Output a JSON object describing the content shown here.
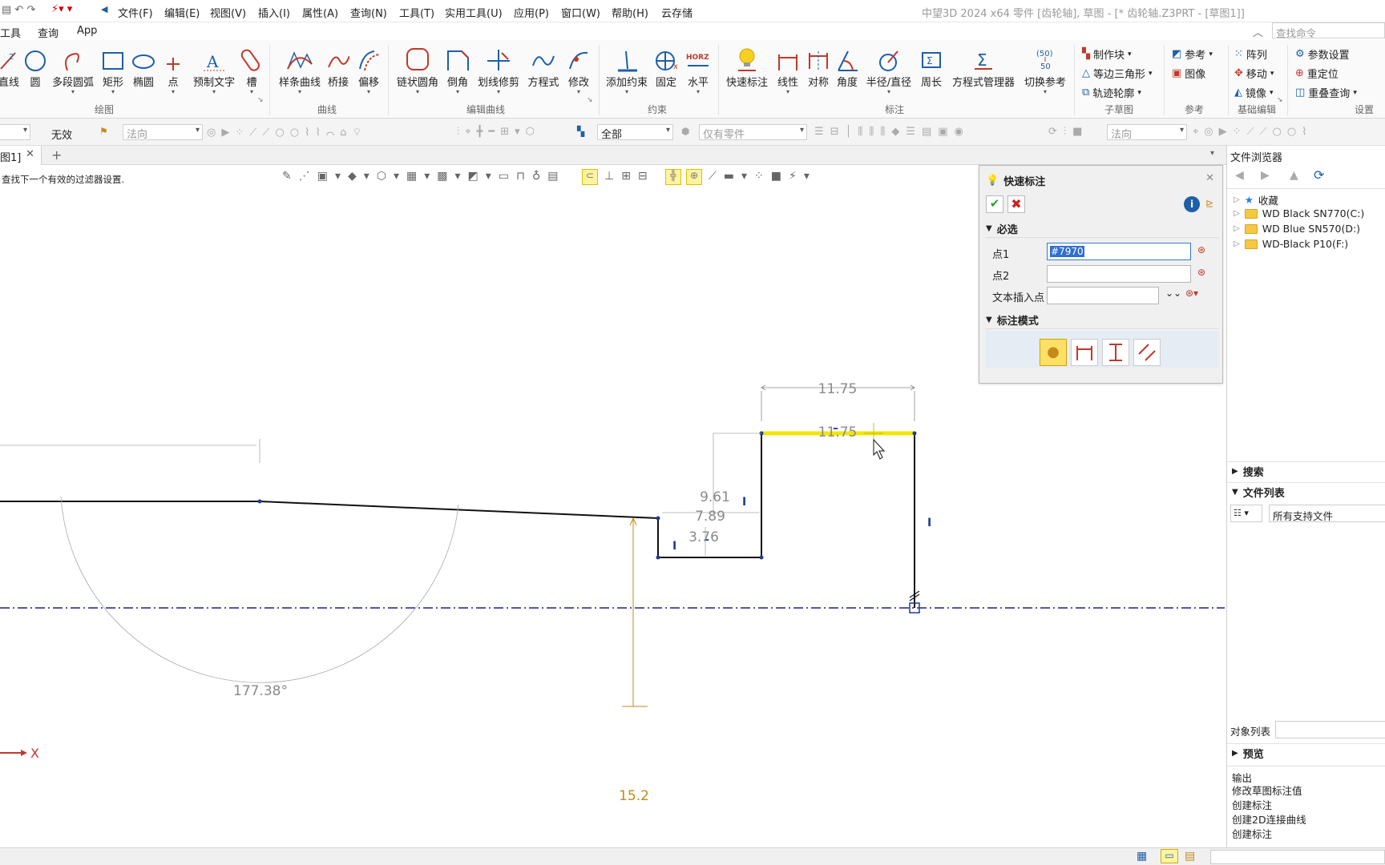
{
  "app": {
    "title_left": "中望3D 2024 x64",
    "title_right": "零件 [齿轮轴], 草图 - [* 齿轮轴.Z3PRT - [草图1]]",
    "search_placeholder": "查找命令"
  },
  "menu": [
    "文件(F)",
    "编辑(E)",
    "视图(V)",
    "插入(I)",
    "属性(A)",
    "查询(N)",
    "工具(T)",
    "实用工具(U)",
    "应用(P)",
    "窗口(W)",
    "帮助(H)",
    "云存储"
  ],
  "ribbon_tabs": [
    "工具",
    "查询",
    "App"
  ],
  "ribbon": {
    "draw": [
      "直线",
      "圆",
      "多段圆弧",
      "矩形",
      "椭圆",
      "点",
      "预制文字",
      "槽"
    ],
    "curve": [
      "样条曲线",
      "桥接",
      "偏移"
    ],
    "edit": [
      "链状圆角",
      "倒角",
      "划线修剪",
      "方程式",
      "修改"
    ],
    "constraint": [
      "添加约束",
      "固定",
      "水平"
    ],
    "dim": [
      "快速标注",
      "线性",
      "对称",
      "角度",
      "半径/直径",
      "周长",
      "方程式管理器",
      "切换参考"
    ],
    "sub_items": [
      "制作块",
      "等边三角形",
      "轨迹轮廓"
    ],
    "ref_items": [
      "参考",
      "图像"
    ],
    "basic_items": [
      "阵列",
      "移动",
      "镜像"
    ],
    "settings_items": [
      "参数设置",
      "重定位",
      "重叠查询"
    ],
    "groups": [
      "绘图",
      "曲线",
      "编辑曲线",
      "约束",
      "标注",
      "子草图",
      "参考",
      "基础编辑",
      "设置"
    ],
    "horz_label": "HORZ",
    "toggle_label_top": "(50)",
    "toggle_label_bottom": "50"
  },
  "toolbar2": {
    "filter_none": "无效",
    "combo1": "法向",
    "combo2": "全部",
    "combo3": "仅有零件",
    "combo4": "法向"
  },
  "doc_tab": "图1]",
  "status_hint": "查找下一个有效的过滤器设置.",
  "quick_dim": {
    "title": "快速标注",
    "required": "必选",
    "p1_label": "点1",
    "p1_value": "#7970",
    "p2_label": "点2",
    "text_label": "文本插入点",
    "mode_label": "标注模式"
  },
  "right_panel": {
    "title": "文件浏览器",
    "tree": [
      "收藏",
      "WD Black SN770(C:)",
      "WD Blue SN570(D:)",
      "WD-Black P10(F:)"
    ],
    "search": "搜索",
    "file_list": "文件列表",
    "file_filter": "所有支持文件",
    "object_list": "对象列表",
    "preview": "预览",
    "output": "输出",
    "output_lines": [
      "修改草图标注值",
      "创建标注",
      "创建2D连接曲线",
      "创建标注"
    ]
  },
  "sketch": {
    "dims": [
      "11.75",
      "11.75",
      "9.61",
      "7.89",
      "3.76",
      "177.38°",
      "15.2"
    ],
    "axis_label": "X"
  },
  "colors": {
    "accent": "#1e5fa8",
    "highlight_line": "#f2e600",
    "dim_orange": "#c58a16",
    "centerline": "#1f1f8f"
  }
}
